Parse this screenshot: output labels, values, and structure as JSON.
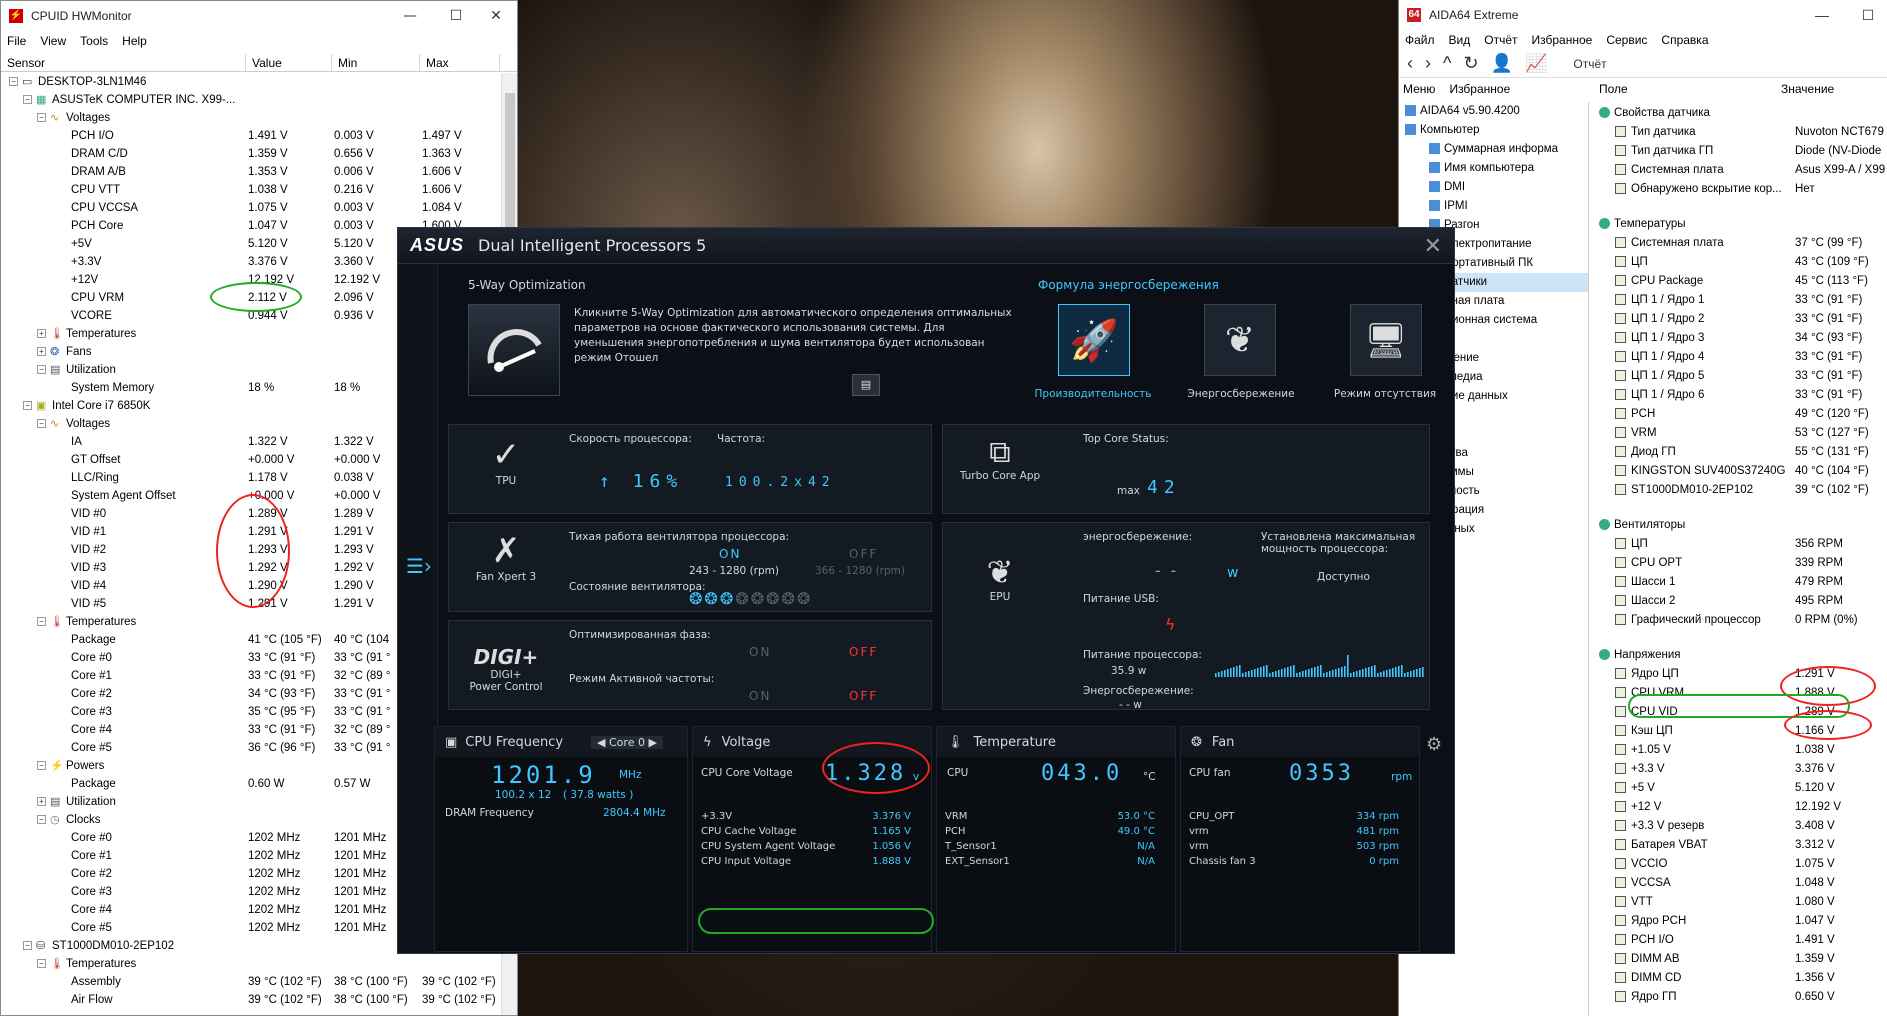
{
  "hw": {
    "title": "CPUID HWMonitor",
    "menu": [
      "File",
      "View",
      "Tools",
      "Help"
    ],
    "cols": [
      "Sensor",
      "Value",
      "Min",
      "Max"
    ],
    "rows": [
      {
        "d": 0,
        "t": "DESKTOP-3LN1M46",
        "v": "",
        "mn": "",
        "mx": "",
        "k": "pc"
      },
      {
        "d": 1,
        "t": "ASUSTeK COMPUTER INC. X99-...",
        "v": "",
        "mn": "",
        "mx": "",
        "k": "mb"
      },
      {
        "d": 2,
        "t": "Voltages",
        "v": "",
        "mn": "",
        "mx": "",
        "k": "volt"
      },
      {
        "d": 3,
        "t": "PCH I/O",
        "v": "1.491 V",
        "mn": "0.003 V",
        "mx": "1.497 V"
      },
      {
        "d": 3,
        "t": "DRAM C/D",
        "v": "1.359 V",
        "mn": "0.656 V",
        "mx": "1.363 V"
      },
      {
        "d": 3,
        "t": "DRAM A/B",
        "v": "1.353 V",
        "mn": "0.006 V",
        "mx": "1.606 V"
      },
      {
        "d": 3,
        "t": "CPU VTT",
        "v": "1.038 V",
        "mn": "0.216 V",
        "mx": "1.606 V"
      },
      {
        "d": 3,
        "t": "CPU VCCSA",
        "v": "1.075 V",
        "mn": "0.003 V",
        "mx": "1.084 V"
      },
      {
        "d": 3,
        "t": "PCH Core",
        "v": "1.047 V",
        "mn": "0.003 V",
        "mx": "1.600 V"
      },
      {
        "d": 3,
        "t": "+5V",
        "v": "5.120 V",
        "mn": "5.120 V",
        "mx": ""
      },
      {
        "d": 3,
        "t": "+3.3V",
        "v": "3.376 V",
        "mn": "3.360 V",
        "mx": ""
      },
      {
        "d": 3,
        "t": "+12V",
        "v": "12.192 V",
        "mn": "12.192 V",
        "mx": ""
      },
      {
        "d": 3,
        "t": "CPU VRM",
        "v": "2.112 V",
        "mn": "2.096 V",
        "mx": ""
      },
      {
        "d": 3,
        "t": "VCORE",
        "v": "0.944 V",
        "mn": "0.936 V",
        "mx": ""
      },
      {
        "d": 2,
        "t": "Temperatures",
        "v": "",
        "mn": "",
        "mx": "",
        "k": "temp",
        "c": "+"
      },
      {
        "d": 2,
        "t": "Fans",
        "v": "",
        "mn": "",
        "mx": "",
        "k": "fan",
        "c": "+"
      },
      {
        "d": 2,
        "t": "Utilization",
        "v": "",
        "mn": "",
        "mx": "",
        "k": "util"
      },
      {
        "d": 3,
        "t": "System Memory",
        "v": "18 %",
        "mn": "18 %",
        "mx": ""
      },
      {
        "d": 1,
        "t": "Intel Core i7 6850K",
        "v": "",
        "mn": "",
        "mx": "",
        "k": "cpu"
      },
      {
        "d": 2,
        "t": "Voltages",
        "v": "",
        "mn": "",
        "mx": "",
        "k": "volt"
      },
      {
        "d": 3,
        "t": "IA",
        "v": "1.322 V",
        "mn": "1.322 V",
        "mx": ""
      },
      {
        "d": 3,
        "t": "GT Offset",
        "v": "+0.000 V",
        "mn": "+0.000 V",
        "mx": ""
      },
      {
        "d": 3,
        "t": "LLC/Ring",
        "v": "1.178 V",
        "mn": "0.038 V",
        "mx": ""
      },
      {
        "d": 3,
        "t": "System Agent Offset",
        "v": "+0.000 V",
        "mn": "+0.000 V",
        "mx": ""
      },
      {
        "d": 3,
        "t": "VID #0",
        "v": "1.289 V",
        "mn": "1.289 V",
        "mx": ""
      },
      {
        "d": 3,
        "t": "VID #1",
        "v": "1.291 V",
        "mn": "1.291 V",
        "mx": ""
      },
      {
        "d": 3,
        "t": "VID #2",
        "v": "1.293 V",
        "mn": "1.293 V",
        "mx": ""
      },
      {
        "d": 3,
        "t": "VID #3",
        "v": "1.292 V",
        "mn": "1.292 V",
        "mx": ""
      },
      {
        "d": 3,
        "t": "VID #4",
        "v": "1.290 V",
        "mn": "1.290 V",
        "mx": ""
      },
      {
        "d": 3,
        "t": "VID #5",
        "v": "1.291 V",
        "mn": "1.291 V",
        "mx": ""
      },
      {
        "d": 2,
        "t": "Temperatures",
        "v": "",
        "mn": "",
        "mx": "",
        "k": "temp"
      },
      {
        "d": 3,
        "t": "Package",
        "v": "41 °C  (105 °F)",
        "mn": "40 °C  (104",
        "mx": ""
      },
      {
        "d": 3,
        "t": "Core #0",
        "v": "33 °C  (91 °F)",
        "mn": "33 °C  (91 °",
        "mx": ""
      },
      {
        "d": 3,
        "t": "Core #1",
        "v": "33 °C  (91 °F)",
        "mn": "32 °C  (89 °",
        "mx": ""
      },
      {
        "d": 3,
        "t": "Core #2",
        "v": "34 °C  (93 °F)",
        "mn": "33 °C  (91 °",
        "mx": ""
      },
      {
        "d": 3,
        "t": "Core #3",
        "v": "35 °C  (95 °F)",
        "mn": "33 °C  (91 °",
        "mx": ""
      },
      {
        "d": 3,
        "t": "Core #4",
        "v": "33 °C  (91 °F)",
        "mn": "32 °C  (89 °",
        "mx": ""
      },
      {
        "d": 3,
        "t": "Core #5",
        "v": "36 °C  (96 °F)",
        "mn": "33 °C  (91 °",
        "mx": ""
      },
      {
        "d": 2,
        "t": "Powers",
        "v": "",
        "mn": "",
        "mx": "",
        "k": "power"
      },
      {
        "d": 3,
        "t": "Package",
        "v": "0.60 W",
        "mn": "0.57 W",
        "mx": ""
      },
      {
        "d": 2,
        "t": "Utilization",
        "v": "",
        "mn": "",
        "mx": "",
        "k": "util",
        "c": "+"
      },
      {
        "d": 2,
        "t": "Clocks",
        "v": "",
        "mn": "",
        "mx": "",
        "k": "clock"
      },
      {
        "d": 3,
        "t": "Core #0",
        "v": "1202 MHz",
        "mn": "1201 MHz",
        "mx": ""
      },
      {
        "d": 3,
        "t": "Core #1",
        "v": "1202 MHz",
        "mn": "1201 MHz",
        "mx": ""
      },
      {
        "d": 3,
        "t": "Core #2",
        "v": "1202 MHz",
        "mn": "1201 MHz",
        "mx": ""
      },
      {
        "d": 3,
        "t": "Core #3",
        "v": "1202 MHz",
        "mn": "1201 MHz",
        "mx": ""
      },
      {
        "d": 3,
        "t": "Core #4",
        "v": "1202 MHz",
        "mn": "1201 MHz",
        "mx": ""
      },
      {
        "d": 3,
        "t": "Core #5",
        "v": "1202 MHz",
        "mn": "1201 MHz",
        "mx": ""
      },
      {
        "d": 1,
        "t": "ST1000DM010-2EP102",
        "v": "",
        "mn": "",
        "mx": "",
        "k": "hdd"
      },
      {
        "d": 2,
        "t": "Temperatures",
        "v": "",
        "mn": "",
        "mx": "",
        "k": "temp"
      },
      {
        "d": 3,
        "t": "Assembly",
        "v": "39 °C  (102 °F)",
        "mn": "38 °C  (100 °F)",
        "mx": "39 °C  (102 °F)"
      },
      {
        "d": 3,
        "t": "Air Flow",
        "v": "39 °C  (102 °F)",
        "mn": "38 °C  (100 °F)",
        "mx": "39 °C  (102 °F)"
      }
    ]
  },
  "aida": {
    "title": "AIDA64 Extreme",
    "menu": [
      "Файл",
      "Вид",
      "Отчёт",
      "Избранное",
      "Сервис",
      "Справка"
    ],
    "report": "Отчёт",
    "tabs": [
      "Меню",
      "Избранное"
    ],
    "cols": [
      "Поле",
      "Значение"
    ],
    "left": [
      {
        "d": 0,
        "t": "AIDA64 v5.90.4200"
      },
      {
        "d": 0,
        "t": "Компьютер"
      },
      {
        "d": 1,
        "t": "Суммарная информа"
      },
      {
        "d": 1,
        "t": "Имя компьютера"
      },
      {
        "d": 1,
        "t": "DMI"
      },
      {
        "d": 1,
        "t": "IPMI"
      },
      {
        "d": 1,
        "t": "Разгон"
      },
      {
        "d": 1,
        "t": "Электропитание"
      },
      {
        "d": 1,
        "t": "Портативный ПК"
      },
      {
        "d": 1,
        "t": "Датчики"
      },
      {
        "d": 0,
        "t": "истемная плата"
      },
      {
        "d": 0,
        "t": "перационная система"
      },
      {
        "d": 0,
        "t": "рвер"
      },
      {
        "d": 0,
        "t": "ображение"
      },
      {
        "d": 0,
        "t": "ультимедиа"
      },
      {
        "d": 0,
        "t": "ранение данных"
      },
      {
        "d": 0,
        "t": "ть"
      },
      {
        "d": 0,
        "t": "rectX"
      },
      {
        "d": 0,
        "t": "тройства"
      },
      {
        "d": 0,
        "t": "рограммы"
      },
      {
        "d": 0,
        "t": "зопасность"
      },
      {
        "d": 0,
        "t": "нфигурация"
      },
      {
        "d": 0,
        "t": "за данных"
      },
      {
        "d": 0,
        "t": "ст"
      }
    ],
    "right": [
      {
        "h": true,
        "t": "Свойства датчика"
      },
      {
        "t": "Тип датчика",
        "v": "Nuvoton NCT679"
      },
      {
        "t": "Тип датчика ГП",
        "v": "Diode  (NV-Diode"
      },
      {
        "t": "Системная плата",
        "v": "Asus X99-A / X99"
      },
      {
        "t": "Обнаружено вскрытие кор...",
        "v": "Нет"
      },
      {
        "gap": true
      },
      {
        "h": true,
        "t": "Температуры"
      },
      {
        "t": "Системная плата",
        "v": "37 °C  (99 °F)"
      },
      {
        "t": "ЦП",
        "v": "43 °C  (109 °F)"
      },
      {
        "t": "CPU Package",
        "v": "45 °C  (113 °F)"
      },
      {
        "t": "ЦП 1 / Ядро 1",
        "v": "33 °C  (91 °F)"
      },
      {
        "t": "ЦП 1 / Ядро 2",
        "v": "33 °C  (91 °F)"
      },
      {
        "t": "ЦП 1 / Ядро 3",
        "v": "34 °C  (93 °F)"
      },
      {
        "t": "ЦП 1 / Ядро 4",
        "v": "33 °C  (91 °F)"
      },
      {
        "t": "ЦП 1 / Ядро 5",
        "v": "33 °C  (91 °F)"
      },
      {
        "t": "ЦП 1 / Ядро 6",
        "v": "33 °C  (91 °F)"
      },
      {
        "t": "PCH",
        "v": "49 °C  (120 °F)"
      },
      {
        "t": "VRM",
        "v": "53 °C  (127 °F)"
      },
      {
        "t": "Диод ГП",
        "v": "55 °C  (131 °F)"
      },
      {
        "t": "KINGSTON SUV400S37240G",
        "v": "40 °C  (104 °F)"
      },
      {
        "t": "ST1000DM010-2EP102",
        "v": "39 °C  (102 °F)"
      },
      {
        "gap": true
      },
      {
        "h": true,
        "t": "Вентиляторы"
      },
      {
        "t": "ЦП",
        "v": "356 RPM"
      },
      {
        "t": "CPU OPT",
        "v": "339 RPM"
      },
      {
        "t": "Шасси 1",
        "v": "479 RPM"
      },
      {
        "t": "Шасси 2",
        "v": "495 RPM"
      },
      {
        "t": "Графический процессор",
        "v": "0 RPM  (0%)"
      },
      {
        "gap": true
      },
      {
        "h": true,
        "t": "Напряжения"
      },
      {
        "t": "Ядро ЦП",
        "v": "1.291 V"
      },
      {
        "t": "CPU VRM",
        "v": "1.888 V"
      },
      {
        "t": "CPU VID",
        "v": "1.289 V"
      },
      {
        "t": "Кэш ЦП",
        "v": "1.166 V"
      },
      {
        "t": "+1.05 V",
        "v": "1.038 V"
      },
      {
        "t": "+3.3 V",
        "v": "3.376 V"
      },
      {
        "t": "+5 V",
        "v": "5.120 V"
      },
      {
        "t": "+12 V",
        "v": "12.192 V"
      },
      {
        "t": "+3.3 V резерв",
        "v": "3.408 V"
      },
      {
        "t": "Батарея VBAT",
        "v": "3.312 V"
      },
      {
        "t": "VCCIO",
        "v": "1.075 V"
      },
      {
        "t": "VCCSA",
        "v": "1.048 V"
      },
      {
        "t": "VTT",
        "v": "1.080 V"
      },
      {
        "t": "Ядро PCH",
        "v": "1.047 V"
      },
      {
        "t": "PCH I/O",
        "v": "1.491 V"
      },
      {
        "t": "DIMM AB",
        "v": "1.359 V"
      },
      {
        "t": "DIMM CD",
        "v": "1.356 V"
      },
      {
        "t": "Ядро ГП",
        "v": "0.650 V"
      }
    ]
  },
  "dip": {
    "logo": "ASUS",
    "title": "Dual Intelligent Processors 5",
    "fiveway_title": "5-Way Optimization",
    "fiveway_desc": "Кликните 5-Way Optimization для автоматического определения оптимальных параметров на основе фактического использования системы. Для уменьшения энергопотребления и шума вентилятора будет использован режим Отошел",
    "formula_title": "Формула энергосбережения",
    "modes": [
      "Производительность",
      "Энергосбережение",
      "Режим отсутствия"
    ],
    "tpu": {
      "label": "TPU",
      "speed_title": "Скорость процессора:",
      "speed": "16%",
      "freq_title": "Частота:",
      "freq": "100.2x42"
    },
    "turbo": {
      "label": "Turbo Core App",
      "status_title": "Top Core Status:",
      "max_label": "max",
      "max": "42"
    },
    "fan": {
      "label": "Fan Xpert 3",
      "quiet_title": "Тихая работа вентилятора процессора:",
      "on": "ON",
      "off": "OFF",
      "range_on": "243 - 1280 (rpm)",
      "range_off": "366 - 1280 (rpm)",
      "state_title": "Состояние вентилятора:"
    },
    "epu": {
      "label": "EPU",
      "save_title": "энергосбережение:",
      "save_val": "--",
      "unit": "w",
      "max_title": "Установлена максимальная мощность процессора:",
      "max_val": "Доступно",
      "usb_title": "Питание USB:",
      "cpu_title": "Питание процессора:",
      "cpu_val": "35.9 w",
      "save2_title": "Энергосбережение:",
      "save2_val": "- - w"
    },
    "digi": {
      "label1": "DIGI+",
      "label2": "Power Control",
      "phase_title": "Оптимизированная фаза:",
      "active_title": "Режим Активной частоты:",
      "on": "ON",
      "off": "OFF"
    },
    "freqp": {
      "title": "CPU Frequency",
      "core": "Core 0",
      "val": "1201.9",
      "unit": "MHz",
      "sub1": "100.2  x  12",
      "sub2": "( 37.8 watts )",
      "dram_label": "DRAM Frequency",
      "dram_val": "2804.4  MHz"
    },
    "voltp": {
      "title": "Voltage",
      "core_label": "CPU Core Voltage",
      "core_val": "1.328",
      "unit": "v",
      "list": [
        {
          "n": "+3.3V",
          "v": "3.376  V"
        },
        {
          "n": "CPU Cache Voltage",
          "v": "1.165  V"
        },
        {
          "n": "CPU System Agent Voltage",
          "v": "1.056  V"
        },
        {
          "n": "CPU Input Voltage",
          "v": "1.888  V"
        }
      ]
    },
    "tempp": {
      "title": "Temperature",
      "cpu_label": "CPU",
      "cpu_val": "043.0",
      "unit": "°C",
      "list": [
        {
          "n": "VRM",
          "v": "53.0 °C"
        },
        {
          "n": "PCH",
          "v": "49.0 °C"
        },
        {
          "n": "T_Sensor1",
          "v": "N/A"
        },
        {
          "n": "EXT_Sensor1",
          "v": "N/A"
        }
      ]
    },
    "fanp": {
      "title": "Fan",
      "cpu_label": "CPU fan",
      "cpu_val": "0353",
      "unit": "rpm",
      "list": [
        {
          "n": "CPU_OPT",
          "v": "334  rpm"
        },
        {
          "n": "vrm",
          "v": "481  rpm"
        },
        {
          "n": "vrm",
          "v": "503  rpm"
        },
        {
          "n": "Chassis fan 3",
          "v": "0  rpm"
        }
      ]
    }
  },
  "colors": {
    "accent": "#3fc8ff",
    "off_red": "#ff3030",
    "annot_red": "#e22222",
    "annot_green": "#22aa22"
  }
}
